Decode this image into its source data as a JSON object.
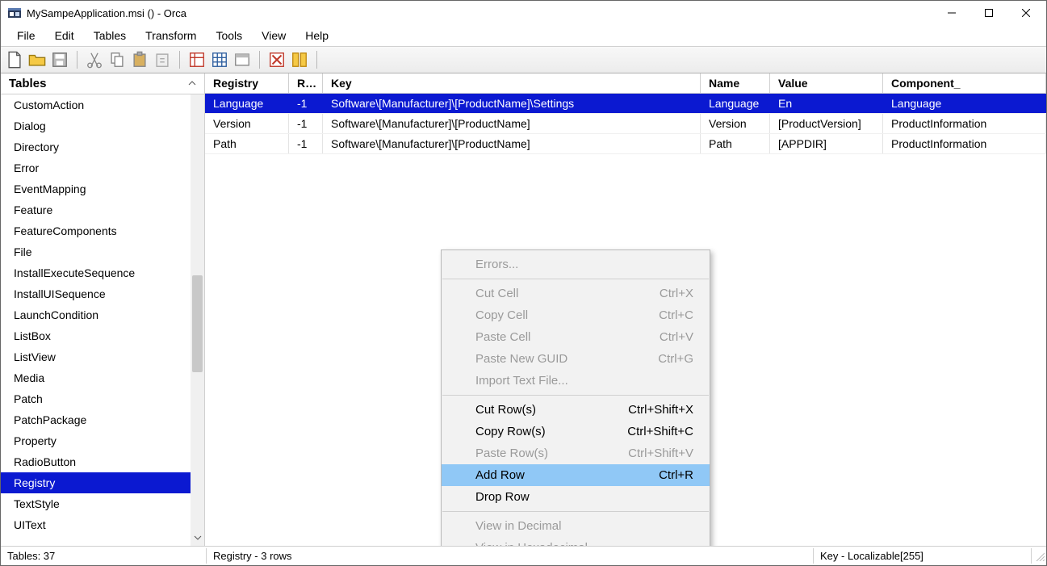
{
  "window": {
    "title": "MySampeApplication.msi () - Orca"
  },
  "menu": {
    "file": "File",
    "edit": "Edit",
    "tables": "Tables",
    "transform": "Transform",
    "tools": "Tools",
    "view": "View",
    "help": "Help"
  },
  "sidebar": {
    "header": "Tables",
    "items": [
      "CustomAction",
      "Dialog",
      "Directory",
      "Error",
      "EventMapping",
      "Feature",
      "FeatureComponents",
      "File",
      "InstallExecuteSequence",
      "InstallUISequence",
      "LaunchCondition",
      "ListBox",
      "ListView",
      "Media",
      "Patch",
      "PatchPackage",
      "Property",
      "RadioButton",
      "Registry",
      "TextStyle",
      "UIText"
    ],
    "selected_index": 18
  },
  "grid": {
    "columns": {
      "registry": "Registry",
      "root": "R...",
      "key": "Key",
      "name": "Name",
      "value": "Value",
      "component": "Component_"
    },
    "rows": [
      {
        "registry": "Language",
        "root": "-1",
        "key": "Software\\[Manufacturer]\\[ProductName]\\Settings",
        "name": "Language",
        "value": "En",
        "component": "Language"
      },
      {
        "registry": "Version",
        "root": "-1",
        "key": "Software\\[Manufacturer]\\[ProductName]",
        "name": "Version",
        "value": "[ProductVersion]",
        "component": "ProductInformation"
      },
      {
        "registry": "Path",
        "root": "-1",
        "key": "Software\\[Manufacturer]\\[ProductName]",
        "name": "Path",
        "value": "[APPDIR]",
        "component": "ProductInformation"
      }
    ],
    "selected_index": 0
  },
  "context_menu": {
    "errors": "Errors...",
    "cut_cell": "Cut Cell",
    "cut_cell_accel": "Ctrl+X",
    "copy_cell": "Copy Cell",
    "copy_cell_accel": "Ctrl+C",
    "paste_cell": "Paste Cell",
    "paste_cell_accel": "Ctrl+V",
    "paste_guid": "Paste New GUID",
    "paste_guid_accel": "Ctrl+G",
    "import_text": "Import Text File...",
    "cut_rows": "Cut Row(s)",
    "cut_rows_accel": "Ctrl+Shift+X",
    "copy_rows": "Copy Row(s)",
    "copy_rows_accel": "Ctrl+Shift+C",
    "paste_rows": "Paste Row(s)",
    "paste_rows_accel": "Ctrl+Shift+V",
    "add_row": "Add Row",
    "add_row_accel": "Ctrl+R",
    "drop_row": "Drop Row",
    "view_dec": "View in Decimal",
    "view_hex": "View in Hexadecimal"
  },
  "status": {
    "tables": "Tables: 37",
    "rows": "Registry - 3 rows",
    "info": "Key - Localizable[255]"
  }
}
